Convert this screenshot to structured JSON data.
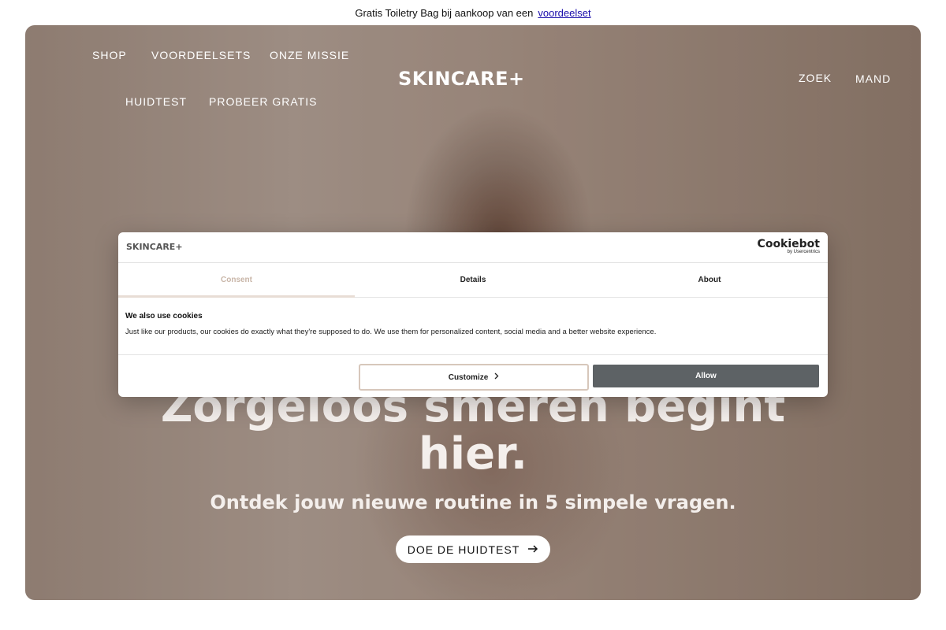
{
  "announcement": {
    "text": "Gratis Toiletry Bag bij aankoop van een",
    "link": "voordeelset"
  },
  "header": {
    "logo": "SKINCARE+",
    "nav_left": [
      "SHOP",
      "VOORDEELSETS",
      "ONZE MISSIE",
      "HUIDTEST",
      "PROBEER GRATIS"
    ],
    "search": "ZOEK",
    "cart": "MAND"
  },
  "hero": {
    "title": "Zorgeloos smeren begint hier.",
    "subtitle": "Ontdek jouw nieuwe routine in 5 simpele vragen.",
    "cta": "DOE DE HUIDTEST",
    "cta_icon": "arrow-right-icon"
  },
  "cookie_dialog": {
    "logo": "SKINCARE+",
    "brand": "Cookiebot",
    "brand_sub": "by Usercentrics",
    "tabs": [
      "Consent",
      "Details",
      "About"
    ],
    "active_tab": "Consent",
    "title": "We also use cookies",
    "text": "Just like our products, our cookies do exactly what they're supposed to do. We use them for personalized content, social media and a better website experience.",
    "customize": "Customize",
    "allow": "Allow",
    "colors": {
      "allow_bg": "#5d6265",
      "active_tab": "#c9b6a8"
    }
  }
}
